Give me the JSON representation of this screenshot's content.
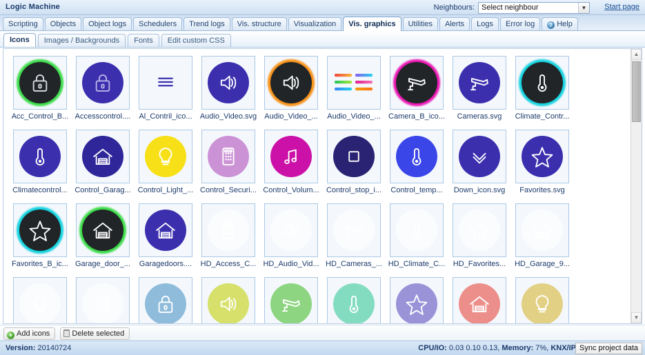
{
  "titlebar": {
    "app_title": "Logic Machine",
    "neighbours_label": "Neighbours:",
    "neighbour_value": "Select neighbour",
    "start_page_link": "Start page",
    "caret_icon": "▼"
  },
  "main_tabs": [
    {
      "label": "Scripting",
      "active": false
    },
    {
      "label": "Objects",
      "active": false
    },
    {
      "label": "Object logs",
      "active": false
    },
    {
      "label": "Schedulers",
      "active": false
    },
    {
      "label": "Trend logs",
      "active": false
    },
    {
      "label": "Vis. structure",
      "active": false
    },
    {
      "label": "Visualization",
      "active": false
    },
    {
      "label": "Vis. graphics",
      "active": true
    },
    {
      "label": "Utilities",
      "active": false
    },
    {
      "label": "Alerts",
      "active": false
    },
    {
      "label": "Logs",
      "active": false
    },
    {
      "label": "Error log",
      "active": false
    },
    {
      "label": "Help",
      "active": false,
      "icon": "help-icon",
      "icon_glyph": "?"
    }
  ],
  "sub_tabs": [
    {
      "label": "Icons",
      "active": true
    },
    {
      "label": "Images / Backgrounds",
      "active": false
    },
    {
      "label": "Fonts",
      "active": false
    },
    {
      "label": "Edit custom CSS",
      "active": false
    }
  ],
  "icon_grid": {
    "rows": [
      [
        {
          "label": "Acc_Control_B...",
          "icon": "lock-icon",
          "disc": "#222528",
          "glow": "#3ddc4a",
          "stroke": "#d8dde3"
        },
        {
          "label": "Accesscontrol....",
          "icon": "lock-icon",
          "disc": "#3b2fae",
          "glow": "",
          "stroke": "#b9b4e8"
        },
        {
          "label": "Al_Contril_ico...",
          "icon": "lines-icon",
          "disc": "",
          "glow": "",
          "stroke": "#3b2fae"
        },
        {
          "label": "Audio_Video.svg",
          "icon": "speaker-icon",
          "disc": "#3b2fae",
          "glow": "",
          "stroke": "#ffffff"
        },
        {
          "label": "Audio_Video_...",
          "icon": "speaker-icon",
          "disc": "#222528",
          "glow": "#f79219",
          "stroke": "#ffffff"
        },
        {
          "label": "Audio_Video_...",
          "icon": "sliders-icon",
          "disc": "",
          "glow": "",
          "stroke": ""
        },
        {
          "label": "Camera_B_ico...",
          "icon": "camera-icon",
          "disc": "#222528",
          "glow": "#ea19b4",
          "stroke": "#ffffff"
        },
        {
          "label": "Cameras.svg",
          "icon": "camera-icon",
          "disc": "#3b2fae",
          "glow": "",
          "stroke": "#ffffff"
        },
        {
          "label": "Climate_Contr...",
          "icon": "thermometer-icon",
          "disc": "#222528",
          "glow": "#17d3e0",
          "stroke": "#ffffff"
        }
      ],
      [
        {
          "label": "Climatecontrol...",
          "icon": "thermometer-icon",
          "disc": "#3b2fae",
          "glow": "",
          "stroke": "#ffffff"
        },
        {
          "label": "Control_Garag...",
          "icon": "garage-icon",
          "disc": "#2f2699",
          "glow": "",
          "stroke": "#ffffff"
        },
        {
          "label": "Control_Light_...",
          "icon": "bulb-icon",
          "disc": "#f7e018",
          "glow": "",
          "stroke": "#ffffff"
        },
        {
          "label": "Control_Securi...",
          "icon": "keypad-icon",
          "disc": "#cc92d6",
          "glow": "",
          "stroke": "#ffffff"
        },
        {
          "label": "Control_Volum...",
          "icon": "music-icon",
          "disc": "#cc11a8",
          "glow": "",
          "stroke": "#ffffff"
        },
        {
          "label": "Control_stop_i...",
          "icon": "stop-icon",
          "disc": "#2a2272",
          "glow": "",
          "stroke": "#ffffff"
        },
        {
          "label": "Control_temp...",
          "icon": "thermometer-icon",
          "disc": "#3b46e8",
          "glow": "",
          "stroke": "#ffffff"
        },
        {
          "label": "Down_icon.svg",
          "icon": "chevron-down-icon",
          "disc": "#3b2fae",
          "glow": "",
          "stroke": "#ffffff"
        },
        {
          "label": "Favorites.svg",
          "icon": "star-icon",
          "disc": "#3b2fae",
          "glow": "",
          "stroke": "#ffffff"
        }
      ],
      [
        {
          "label": "Favorites_B_ic...",
          "icon": "star-icon",
          "disc": "#222528",
          "glow": "#17d3e0",
          "stroke": "#ffffff"
        },
        {
          "label": "Garage_door_...",
          "icon": "garage-icon",
          "disc": "#222528",
          "glow": "#3ddc4a",
          "stroke": "#ffffff"
        },
        {
          "label": "Garagedoors....",
          "icon": "garage-icon",
          "disc": "#3b2fae",
          "glow": "",
          "stroke": "#ffffff"
        },
        {
          "label": "HD_Access_C...",
          "icon": "keypad-icon",
          "disc": "#fbfcfe",
          "glow": "",
          "stroke": "#ffffff"
        },
        {
          "label": "HD_Audio_Vid...",
          "icon": "speaker-icon",
          "disc": "#fbfcfe",
          "glow": "",
          "stroke": "#ffffff"
        },
        {
          "label": "HD_Cameras_...",
          "icon": "camera-icon",
          "disc": "#fbfcfe",
          "glow": "",
          "stroke": "#ffffff"
        },
        {
          "label": "HD_Climate_C...",
          "icon": "thermometer-icon",
          "disc": "#fbfcfe",
          "glow": "",
          "stroke": "#ffffff"
        },
        {
          "label": "HD_Favorites...",
          "icon": "star-icon",
          "disc": "#fbfcfe",
          "glow": "",
          "stroke": "#ffffff"
        },
        {
          "label": "HD_Garage_9...",
          "icon": "garage-icon",
          "disc": "#fbfcfe",
          "glow": "",
          "stroke": "#ffffff"
        }
      ],
      [
        {
          "label": "",
          "icon": "bulb-icon",
          "disc": "#fbfcfe",
          "glow": "",
          "stroke": "#ffffff"
        },
        {
          "label": "",
          "icon": "blinds-icon",
          "disc": "#fbfcfe",
          "glow": "",
          "stroke": "#ffffff"
        },
        {
          "label": "",
          "icon": "lock-icon",
          "disc": "#8fbcdb",
          "glow": "",
          "stroke": "#ffffff"
        },
        {
          "label": "",
          "icon": "speaker-icon",
          "disc": "#d6e06a",
          "glow": "",
          "stroke": "#ffffff"
        },
        {
          "label": "",
          "icon": "camera-icon",
          "disc": "#8ed581",
          "glow": "",
          "stroke": "#ffffff"
        },
        {
          "label": "",
          "icon": "thermometer-icon",
          "disc": "#84dcc0",
          "glow": "",
          "stroke": "#ffffff"
        },
        {
          "label": "",
          "icon": "star-icon",
          "disc": "#9a93d8",
          "glow": "",
          "stroke": "#ffffff"
        },
        {
          "label": "",
          "icon": "garage-icon",
          "disc": "#ec8f8a",
          "glow": "",
          "stroke": "#ffffff"
        },
        {
          "label": "",
          "icon": "bulb-icon",
          "disc": "#e2d184",
          "glow": "",
          "stroke": "#ffffff"
        }
      ]
    ]
  },
  "scrollbar": {
    "up_glyph": "▲",
    "down_glyph": "▼"
  },
  "toolbar": {
    "add_icons_label": "Add icons",
    "add_icons_glyph": "+",
    "delete_selected_label": "Delete selected"
  },
  "statusbar": {
    "version_label": "Version:",
    "version_value": "20140724",
    "cpu_label": "CPU/IO:",
    "cpu_value": "0.03 0.10 0.13,",
    "memory_label": "Memory:",
    "memory_value": "7%,",
    "knx_label": "KNX/IP",
    "sync_label": "Sync project data"
  }
}
